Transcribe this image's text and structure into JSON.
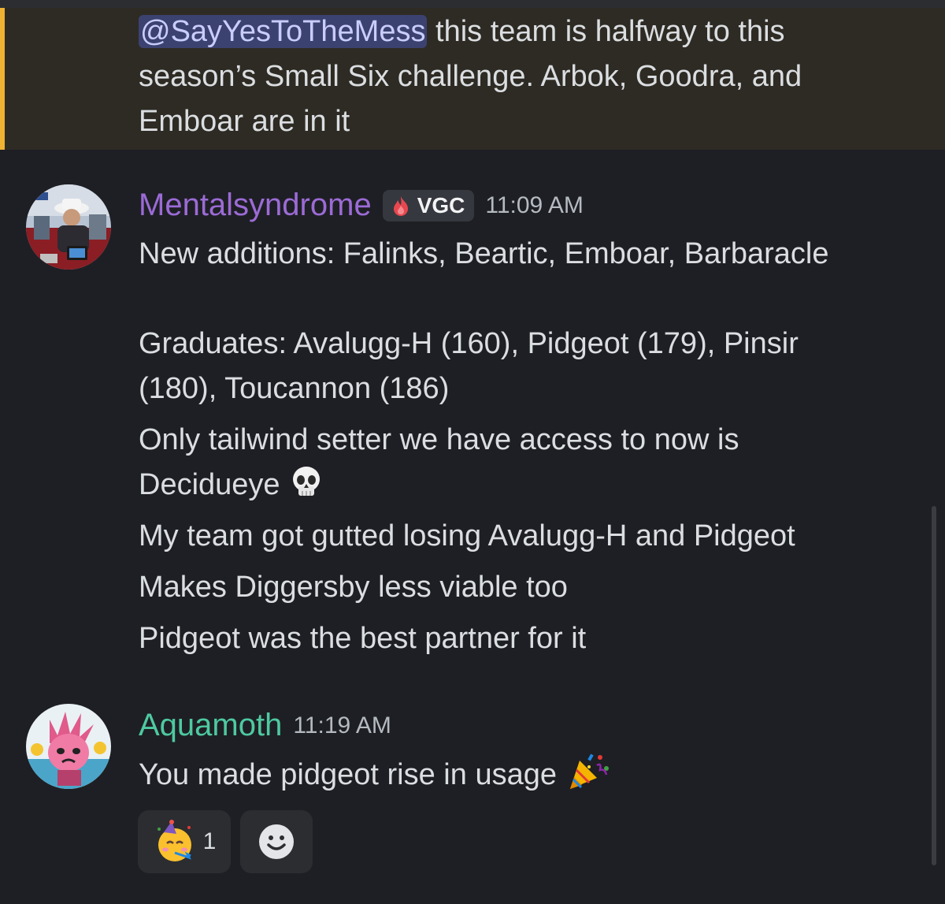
{
  "highlighted_message": {
    "mention": "@SayYesToTheMess",
    "text_line1": " this team is halfway to this",
    "text_line2": "season’s Small Six challenge. Arbok, Goodra, and",
    "text_line3": "Emboar are in it"
  },
  "messages": [
    {
      "username": "Mentalsyndrome",
      "username_color": "#9c6bd6",
      "tag": "VGC",
      "tag_icon": "fire-icon",
      "timestamp": "11:09 AM",
      "lines": [
        "New additions: Falinks, Beartic, Emboar, Barbaracle",
        "",
        "Graduates: Avalugg-H (160), Pidgeot (179), Pinsir",
        "(180), Toucannon (186)",
        "Only tailwind setter we have access to now is",
        "Decidueye",
        "My team got gutted losing Avalugg-H and Pidgeot",
        "Makes Diggersby less viable too",
        "Pidgeot was the best partner for it"
      ],
      "emoji_after_line6": "skull-emoji"
    },
    {
      "username": "Aquamoth",
      "username_color": "#4ec9a0",
      "timestamp": "11:19 AM",
      "lines": [
        "You made pidgeot rise in usage"
      ],
      "emoji_after_line1": "party-popper-emoji"
    }
  ],
  "reactions": [
    {
      "emoji": "partying-face-emoji",
      "count": "1"
    },
    {
      "emoji": "add-reaction-icon",
      "count": ""
    }
  ]
}
